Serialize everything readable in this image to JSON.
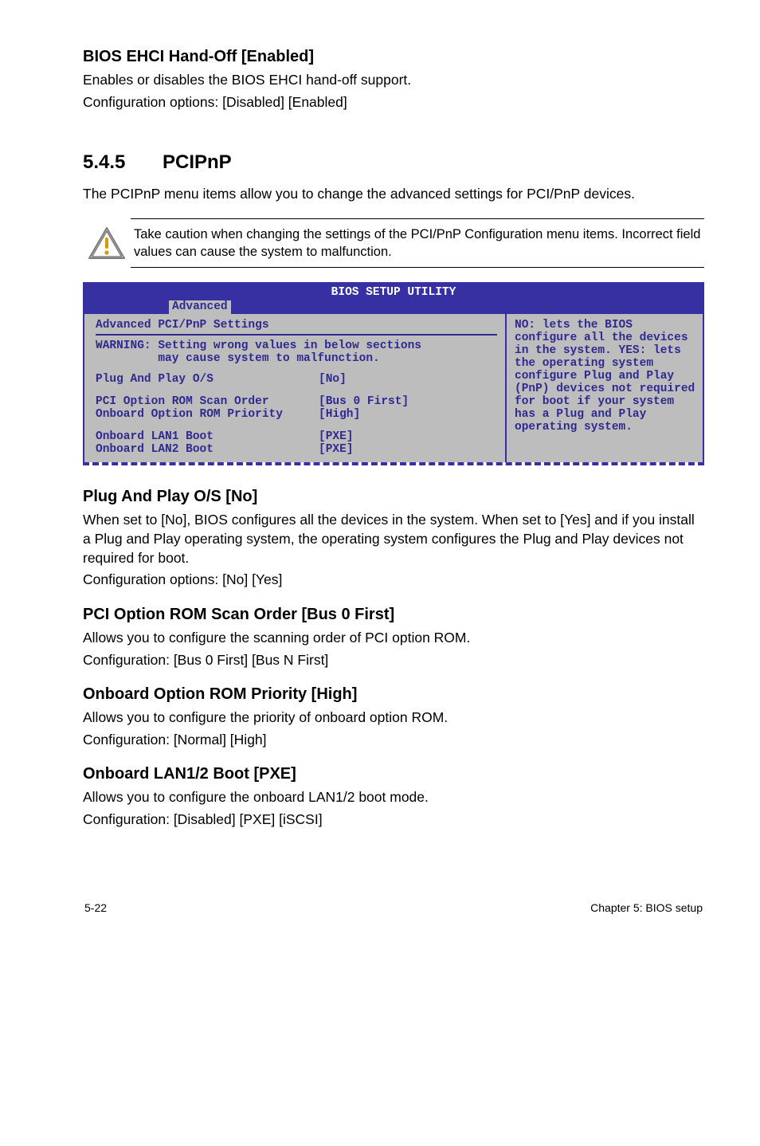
{
  "s1": {
    "heading": "BIOS EHCI Hand-Off [Enabled]",
    "p1": "Enables or disables the BIOS EHCI hand-off support.",
    "p2": "Configuration options: [Disabled] [Enabled]"
  },
  "s2": {
    "num": "5.4.5",
    "title": "PCIPnP",
    "intro": "The PCIPnP menu items allow you to change the advanced settings for PCI/PnP devices.",
    "callout": "Take caution when changing the settings of the PCI/PnP Configuration menu items. Incorrect field values can cause the system to malfunction."
  },
  "bios": {
    "title": "BIOS SETUP UTILITY",
    "tab": "Advanced",
    "left": {
      "heading": "Advanced PCI/PnP Settings",
      "warn1": "WARNING: Setting wrong values in below sections",
      "warn2": "         may cause system to malfunction.",
      "rows": [
        {
          "k": "Plug And Play O/S",
          "v": "[No]"
        },
        {
          "k": "PCI Option ROM Scan Order",
          "v": "[Bus 0 First]"
        },
        {
          "k": "Onboard Option ROM Priority",
          "v": "[High]"
        },
        {
          "k": "Onboard LAN1 Boot",
          "v": "[PXE]"
        },
        {
          "k": "Onboard LAN2 Boot",
          "v": "[PXE]"
        }
      ]
    },
    "right": "NO: lets the BIOS configure all the devices in the system. YES: lets the operating system configure Plug and Play (PnP) devices not required for boot if your system has a Plug and Play operating system."
  },
  "s3": {
    "heading": "Plug And Play O/S [No]",
    "p1": "When set to [No], BIOS configures all the devices in the system. When set to [Yes] and if you install a Plug and Play operating system, the operating system configures the Plug and Play devices not required for boot.",
    "p2": "Configuration options: [No] [Yes]"
  },
  "s4": {
    "heading": "PCI Option ROM Scan Order [Bus 0 First]",
    "p1": "Allows you to configure the scanning order of PCI option ROM.",
    "p2": "Configuration: [Bus 0 First] [Bus N First]"
  },
  "s5": {
    "heading": "Onboard Option ROM Priority [High]",
    "p1": "Allows you to configure the priority of onboard option ROM.",
    "p2": "Configuration: [Normal] [High]"
  },
  "s6": {
    "heading": "Onboard LAN1/2 Boot [PXE]",
    "p1": "Allows you to configure the onboard LAN1/2 boot mode.",
    "p2": "Configuration: [Disabled] [PXE] [iSCSI]"
  },
  "footer": {
    "left": "5-22",
    "right": "Chapter 5: BIOS setup"
  }
}
